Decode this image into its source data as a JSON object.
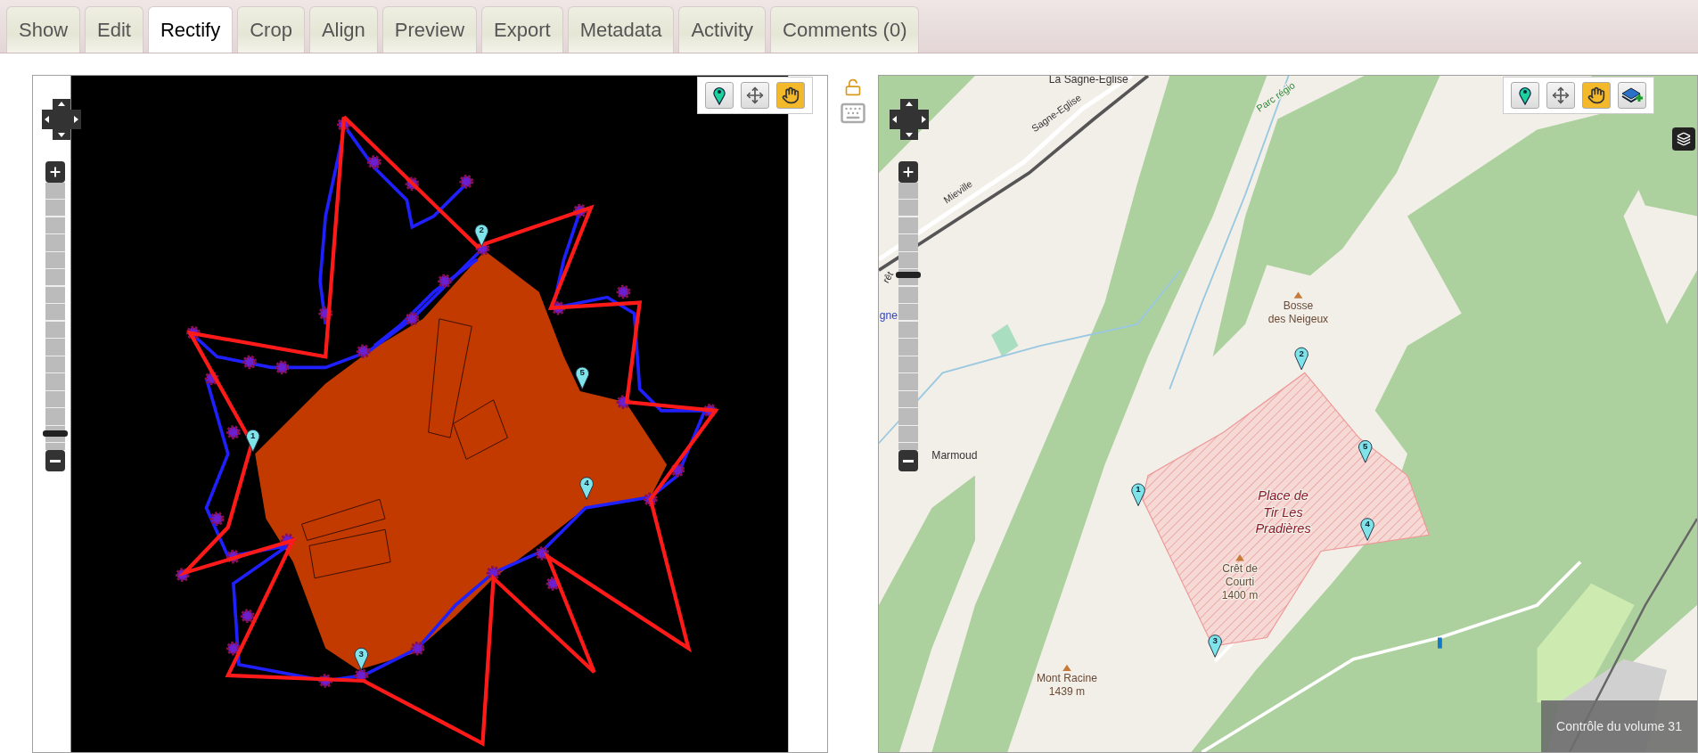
{
  "tabs": [
    {
      "label": "Show",
      "selected": false
    },
    {
      "label": "Edit",
      "selected": false
    },
    {
      "label": "Rectify",
      "selected": true
    },
    {
      "label": "Crop",
      "selected": false
    },
    {
      "label": "Align",
      "selected": false
    },
    {
      "label": "Preview",
      "selected": false
    },
    {
      "label": "Export",
      "selected": false
    },
    {
      "label": "Metadata",
      "selected": false
    },
    {
      "label": "Activity",
      "selected": false
    },
    {
      "label": "Comments (0)",
      "selected": false
    }
  ],
  "image_map": {
    "tools": [
      {
        "kind": "add-point",
        "selected": false
      },
      {
        "kind": "move",
        "selected": false
      },
      {
        "kind": "pan",
        "selected": true
      }
    ],
    "zoom": {
      "level": 0.05
    },
    "markers": [
      "1",
      "2",
      "3",
      "4",
      "5"
    ]
  },
  "side_controls": {
    "locked": false
  },
  "reference_map": {
    "tools": [
      {
        "kind": "add-point",
        "selected": false
      },
      {
        "kind": "move",
        "selected": false
      },
      {
        "kind": "pan",
        "selected": true
      },
      {
        "kind": "add-layer",
        "selected": false
      }
    ],
    "zoom": {
      "level": 0.66
    },
    "markers": [
      "1",
      "2",
      "3",
      "4",
      "5"
    ],
    "labels": [
      {
        "kind": "town",
        "lines": [
          "La Sagne-Eglise"
        ]
      },
      {
        "kind": "road",
        "lines": [
          "Sagne-Eglise"
        ]
      },
      {
        "kind": "road",
        "lines": [
          "Mieville"
        ]
      },
      {
        "kind": "park",
        "lines": [
          "Parc régio"
        ]
      },
      {
        "kind": "road",
        "lines": [
          "rêt"
        ]
      },
      {
        "kind": "station",
        "lines": [
          "gne"
        ]
      },
      {
        "kind": "peak",
        "lines": [
          "Bosse",
          "des Neigeux"
        ]
      },
      {
        "kind": "town",
        "lines": [
          "Marmoud"
        ]
      },
      {
        "kind": "zone",
        "lines": [
          "Place de",
          "Tir Les",
          "Pradières"
        ]
      },
      {
        "kind": "peak",
        "lines": [
          "Crêt de",
          "Courti",
          "1400 m"
        ]
      },
      {
        "kind": "peak",
        "lines": [
          "Mont Racine",
          "1439 m"
        ]
      }
    ]
  },
  "volume_overlay": "Contrôle du volume 31"
}
